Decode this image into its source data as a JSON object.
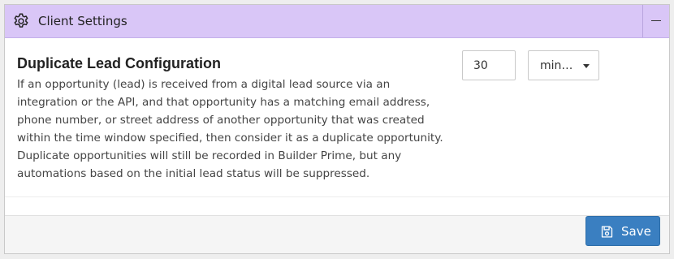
{
  "header": {
    "title": "Client Settings",
    "icon": "gear-icon",
    "collapse_icon": "minus-icon",
    "background_color": "#d9c6f7"
  },
  "section": {
    "title": "Duplicate Lead Configuration",
    "description": "If an opportunity (lead) is received from a digital lead source via an integration or the API, and that opportunity has a matching email address, phone number, or street address of another opportunity that was created within the time window specified, then consider it as a duplicate opportunity. Duplicate opportunities will still be recorded in Builder Prime, but any automations based on the initial lead status will be suppressed."
  },
  "time_window": {
    "value": "30",
    "unit_display": "min…",
    "unit_icon": "caret-down-icon"
  },
  "footer": {
    "save_label": "Save",
    "save_icon": "floppy-disk-icon",
    "save_color": "#3a7fc1"
  }
}
